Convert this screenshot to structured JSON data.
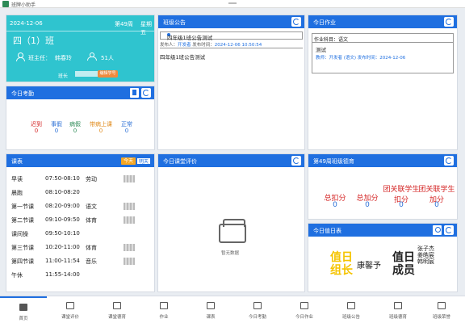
{
  "app": {
    "title": "班牌小助手"
  },
  "class_card": {
    "date": "2024-12-06",
    "week": "第49周",
    "weekday": "星期五",
    "class_name": "四（1）班",
    "head_teacher_label": "班主任：",
    "head_teacher": "韩春玲",
    "student_count": "51人",
    "monitor_label": "班长",
    "monitor_button": "编辑学号"
  },
  "attendance": {
    "title": "今日考勤",
    "stats": [
      {
        "label": "迟到",
        "value": "0",
        "color": "#d42424"
      },
      {
        "label": "事假",
        "value": "0",
        "color": "#2a6fd6"
      },
      {
        "label": "病假",
        "value": "0",
        "color": "#2e8b57"
      },
      {
        "label": "带病上课",
        "value": "0",
        "color": "#e08a1a"
      },
      {
        "label": "正常",
        "value": "0",
        "color": "#2a6fd6"
      }
    ]
  },
  "notice": {
    "title": "班级公告",
    "item_title": "四年级1班公告测试",
    "publisher_label": "发布人：",
    "publisher": "开发者",
    "time_label": "发布时间：",
    "time": "2024-12-06 10:50:54",
    "content": "四年级1班公告测试"
  },
  "homework": {
    "title": "今日作业",
    "subject_label": "作业科目：",
    "subject": "语文",
    "content": "测试",
    "meta": "教师：开发者 (语文)   发布时间：2024-12-06"
  },
  "schedule": {
    "title": "课表",
    "today_label": "今天",
    "tomorrow_label": "明天",
    "rows": [
      {
        "name": "早读",
        "time": "07:50-08:10",
        "subject": "劳动"
      },
      {
        "name": "晨跑",
        "time": "08:10-08:20",
        "subject": ""
      },
      {
        "name": "第一节课",
        "time": "08:20-09:00",
        "subject": "语文"
      },
      {
        "name": "第二节课",
        "time": "09:10-09:50",
        "subject": "体育"
      },
      {
        "name": "课间操",
        "time": "09:50-10:10",
        "subject": ""
      },
      {
        "name": "第三节课",
        "time": "10:20-11:00",
        "subject": "体育"
      },
      {
        "name": "第四节课",
        "time": "11:00-11:54",
        "subject": "音乐"
      },
      {
        "name": "午休",
        "time": "11:55-14:00",
        "subject": ""
      }
    ]
  },
  "evaluation": {
    "title": "今日课堂评价",
    "empty_text": "暂无数据"
  },
  "scores": {
    "title": "第49周班级德育",
    "items": [
      {
        "label": "总扣分",
        "value": "0"
      },
      {
        "label": "总加分",
        "value": "0"
      },
      {
        "label": "团关联学生扣分",
        "value": "0"
      },
      {
        "label": "团关联学生加分",
        "value": "0"
      }
    ]
  },
  "duty": {
    "title": "今日值日表",
    "leader_label": "值日组长",
    "leader": "康馨予",
    "member_label": "值日成员",
    "members": [
      "张子杰",
      "姜皓宸",
      "韩明宸"
    ]
  },
  "tabs": [
    {
      "label": "首页",
      "icon": "home-icon"
    },
    {
      "label": "课堂评价",
      "icon": "search-icon"
    },
    {
      "label": "课堂德育",
      "icon": "book-icon"
    },
    {
      "label": "作业",
      "icon": "briefcase-icon"
    },
    {
      "label": "课表",
      "icon": "list-icon"
    },
    {
      "label": "今日考勤",
      "icon": "calendar-icon"
    },
    {
      "label": "今日作业",
      "icon": "pen-icon"
    },
    {
      "label": "班级公告",
      "icon": "megaphone-icon"
    },
    {
      "label": "班级德育",
      "icon": "tree-icon"
    },
    {
      "label": "班级荣誉",
      "icon": "gear-icon"
    }
  ]
}
